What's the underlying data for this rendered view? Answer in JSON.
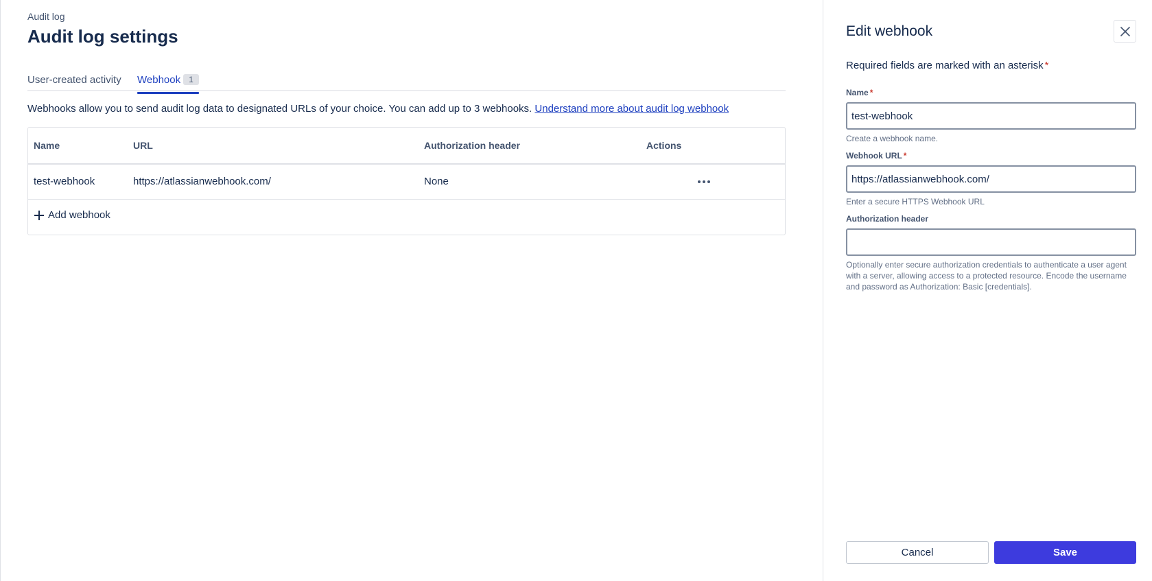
{
  "page": {
    "breadcrumb": "Audit log",
    "title": "Audit log settings",
    "tabs": [
      {
        "label": "User-created activity"
      },
      {
        "label": "Webhook",
        "badge": "1"
      }
    ],
    "description": "Webhooks allow you to send audit log data to designated URLs of your choice. You can add up to 3 webhooks.",
    "learn_more_link": "Understand more about audit log webhook"
  },
  "table": {
    "columns": [
      "Name",
      "URL",
      "Authorization header",
      "Actions"
    ],
    "rows": [
      {
        "name": "test-webhook",
        "url": "https://atlassianwebhook.com/",
        "auth": "None"
      }
    ],
    "add_label": "Add webhook"
  },
  "panel": {
    "title": "Edit webhook",
    "required_note": "Required fields are marked with an asterisk",
    "asterisk": "*",
    "fields": {
      "name": {
        "label": "Name",
        "value": "test-webhook",
        "help": "Create a webhook name."
      },
      "url": {
        "label": "Webhook URL",
        "value": "https://atlassianwebhook.com/",
        "help": "Enter a secure HTTPS Webhook URL"
      },
      "auth": {
        "label": "Authorization header",
        "value": "",
        "help": "Optionally enter secure authorization credentials to authenticate a user agent with a server, allowing access to a protected resource. Encode the username and password as Authorization: Basic [credentials]."
      }
    },
    "cancel_label": "Cancel",
    "save_label": "Save"
  },
  "colors": {
    "accent": "#1d3fbf",
    "primary_button": "#3d3bde",
    "required": "#c9372c",
    "text": "#172b4d"
  },
  "icons": [
    "plus-icon",
    "more-horizontal-icon",
    "close-icon"
  ]
}
